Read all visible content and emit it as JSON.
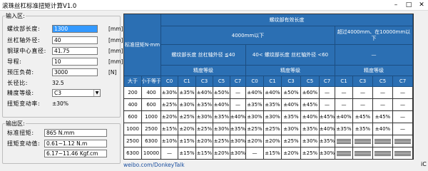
{
  "window": {
    "title": "滚珠丝杠标准扭矩计算V1.0"
  },
  "input": {
    "legend": "输入区:",
    "fields": [
      {
        "label": "螺纹部长度:",
        "value": "1300",
        "unit": "[mm]"
      },
      {
        "label": "丝杠轴外径:",
        "value": "40",
        "unit": "[mm]"
      },
      {
        "label": "钢球中心直径:",
        "value": "41.75",
        "unit": "[mm]"
      },
      {
        "label": "导程:",
        "value": "10",
        "unit": "[mm]"
      },
      {
        "label": "预压负荷:",
        "value": "3000",
        "unit": "[N]"
      }
    ],
    "ratio_label": "长径比:",
    "ratio_value": "32.5",
    "grade_label": "精度等级:",
    "grade_value": "C3",
    "variation_label": "扭矩变动率:",
    "variation_value": "±30%"
  },
  "output": {
    "legend": "输出区:",
    "torque_label": "标准扭矩:",
    "torque_value": "865 N.mm",
    "range_label": "扭矩变动值:",
    "range_value1": "0.61~1.12 N.m",
    "range_value2": "6.17~11.46 Kgf.cm"
  },
  "table": {
    "h_torque": "标准扭矩",
    "h_torque_unit": "N·mm",
    "h_effective": "螺纹部有效长度",
    "h_under4000": "4000mm以下",
    "h_over4000": "超过4000mm、在10000mm以下",
    "h_ratio1": "螺纹部长度 丝杠轴外径 ≦40",
    "h_ratio2": "40< 螺纹部长度 丝杠轴外径 <60",
    "h_dash": "—",
    "h_grade": "精度等级",
    "h_gt": "大于",
    "h_le": "小于等于",
    "grades": [
      "C0",
      "C1",
      "C3",
      "C5",
      "C7"
    ],
    "rows": [
      [
        "200",
        "400",
        "±30%",
        "±35%",
        "±40%",
        "±50%",
        "—",
        "±40%",
        "±40%",
        "±50%",
        "±60%",
        "—",
        "—",
        "—",
        "—",
        "—",
        "—"
      ],
      [
        "400",
        "600",
        "±25%",
        "±30%",
        "±35%",
        "±40%",
        "—",
        "±35%",
        "±35%",
        "±40%",
        "±45%",
        "—",
        "—",
        "—",
        "—",
        "—",
        "—"
      ],
      [
        "600",
        "1000",
        "±20%",
        "±25%",
        "±30%",
        "±35%",
        "±40%",
        "±30%",
        "±30%",
        "±35%",
        "±40%",
        "±45%",
        "—",
        "±40%",
        "±45%",
        "±45%",
        "—"
      ],
      [
        "1000",
        "2500",
        "±15%",
        "±20%",
        "±25%",
        "±30%",
        "±35%",
        "±25%",
        "±25%",
        "±30%",
        "±35%",
        "±40%",
        "—",
        "±35%",
        "±35%",
        "±40%",
        "—"
      ],
      [
        "2500",
        "6300",
        "±10%",
        "±15%",
        "±20%",
        "±25%",
        "±30%",
        "±20%",
        "±20%",
        "±25%",
        "±30%",
        "±35%",
        "—",
        "",
        "",
        "",
        ""
      ],
      [
        "6300",
        "10000",
        "—",
        "±15%",
        "±15%",
        "±20%",
        "±30%",
        "—",
        "±15%",
        "±20%",
        "±25%",
        "±30%",
        "—",
        "",
        "",
        "",
        ""
      ]
    ]
  },
  "footer": {
    "link": "weibo.com/DonkeyTalk",
    "ic": "iC"
  }
}
